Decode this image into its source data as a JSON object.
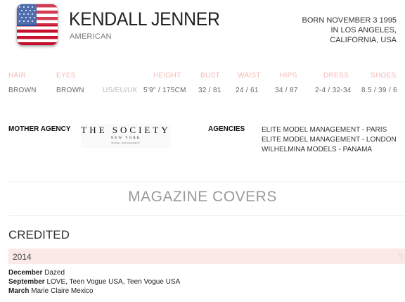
{
  "profile": {
    "name": "KENDALL JENNER",
    "nationality": "AMERICAN",
    "born_line1": "BORN NOVEMBER 3 1995",
    "born_line2": "IN LOS ANGELES,",
    "born_line3": "CALIFORNIA, USA",
    "flag_icon": "us-flag-icon"
  },
  "stats": {
    "labels": [
      "HAIR",
      "EYES",
      "HEIGHT",
      "BUST",
      "WAIST",
      "HIPS",
      "DRESS",
      "SHOES"
    ],
    "hair": "BROWN",
    "eyes": "BROWN",
    "height_prefix": "US/EU/UK",
    "height": "5'9\" / 175CM",
    "bust": "32 / 81",
    "waist": "24 / 61",
    "hips": "34 / 87",
    "dress": "2-4 / 32-34",
    "shoes": "8.5 / 39 / 6"
  },
  "agency": {
    "mother_label": "MOTHER AGENCY",
    "mother_logo_text": "THE SOCIETY",
    "mother_logo_sub": "NEW YORK",
    "mother_logo_tiny": "MODEL MANAGEMENT",
    "agencies_label": "AGENCIES",
    "agencies": [
      "ELITE MODEL MANAGEMENT - PARIS",
      "ELITE MODEL MANAGEMENT - LONDON",
      "WILHELMINA MODELS - PANAMA"
    ]
  },
  "magazine": {
    "section_title": "MAGAZINE COVERS",
    "credited_title": "CREDITED",
    "year": "2014",
    "count": "5",
    "covers": [
      {
        "month": "December",
        "titles": "Dazed"
      },
      {
        "month": "September",
        "titles": "LOVE, Teen Vogue USA, Teen Vogue USA"
      },
      {
        "month": "March",
        "titles": "Marie Claire Mexico"
      }
    ]
  },
  "colors": {
    "stat_label": "#f3b7b3",
    "year_bar": "#fbe9e8"
  }
}
